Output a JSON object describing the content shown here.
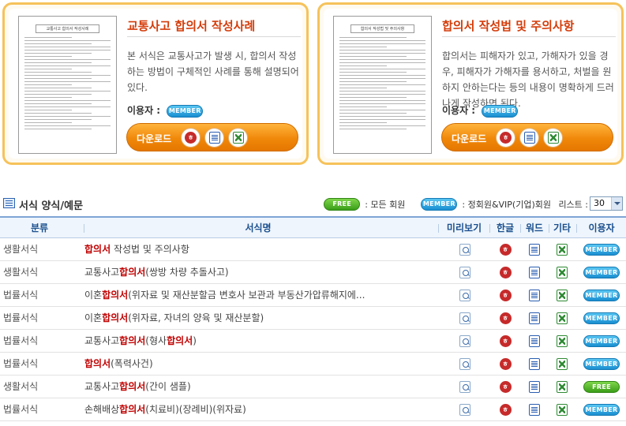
{
  "featured": [
    {
      "title": "교통사고 합의서 작성사례",
      "thumb_title": "교통사고 합의서 작성사례",
      "description": "본 서식은 교통사고가 발생 시, 합의서 작성하는 방법이 구체적인 사례를 통해 설명되어 있다.",
      "user_label": "이용자 :",
      "badge": "MEMBER",
      "download_label": "다운로드"
    },
    {
      "title": "합의서 작성법 및 주의사항",
      "thumb_title": "합의서 작성법 및 주의사항",
      "description": "합의서는 피해자가 있고, 가해자가 있을 경우, 피해자가 가해자를 용서하고, 처벌을 원하지 안하는다는 등의 내용이 명확하게 드러나게 작성하면 된다.",
      "user_label": "이용자 :",
      "badge": "MEMBER",
      "download_label": "다운로드"
    }
  ],
  "list_header": {
    "title": "서식 양식/예문",
    "legend_free_badge": "FREE",
    "legend_free_text": ": 모든 회원",
    "legend_member_badge": "MEMBER",
    "legend_member_text": ": 정회원&VIP(기업)회원",
    "list_label": "리스트 :",
    "list_count": "30"
  },
  "table": {
    "headers": {
      "category": "분류",
      "name": "서식명",
      "preview": "미리보기",
      "hwp": "한글",
      "word": "워드",
      "etc": "기타",
      "user": "이용자"
    },
    "rows": [
      {
        "category": "생활서식",
        "name_pre": "",
        "name_hl": "합의서",
        "name_post": " 작성법 및 주의사항",
        "badge": "MEMBER"
      },
      {
        "category": "생활서식",
        "name_pre": "교통사고",
        "name_hl": "합의서",
        "name_post": "(쌍방 차량 추돌사고)",
        "badge": "MEMBER"
      },
      {
        "category": "법률서식",
        "name_pre": "이혼",
        "name_hl": "합의서",
        "name_post": "(위자료 및 재산분할금 변호사 보관과 부동산가압류해지에...",
        "badge": "MEMBER"
      },
      {
        "category": "법률서식",
        "name_pre": "이혼",
        "name_hl": "합의서",
        "name_post": "(위자료, 자녀의 양육 및 재산분할)",
        "badge": "MEMBER"
      },
      {
        "category": "법률서식",
        "name_pre": "교통사고",
        "name_hl": "합의서",
        "name_post": "(형사",
        "name_hl2": "합의서",
        "name_post2": ")",
        "badge": "MEMBER"
      },
      {
        "category": "법률서식",
        "name_pre": "",
        "name_hl": "합의서",
        "name_post": "(폭력사건)",
        "badge": "MEMBER"
      },
      {
        "category": "생활서식",
        "name_pre": "교통사고",
        "name_hl": "합의서",
        "name_post": "(간이 샘플)",
        "badge": "FREE"
      },
      {
        "category": "법률서식",
        "name_pre": "손해배상",
        "name_hl": "합의서",
        "name_post": "(치료비)(장례비)(위자료)",
        "badge": "MEMBER"
      }
    ]
  },
  "icons": {
    "hwp": "hwp-file-icon",
    "word": "word-file-icon",
    "xls": "excel-file-icon",
    "preview": "magnifier-preview-icon",
    "list": "list-icon"
  },
  "colors": {
    "accent_orange": "#f0880a",
    "title_red": "#d43d0b",
    "highlight_red": "#c00000",
    "member_blue": "#1a8fd1",
    "free_green": "#3b9e19",
    "header_blue": "#1a4f8e"
  }
}
